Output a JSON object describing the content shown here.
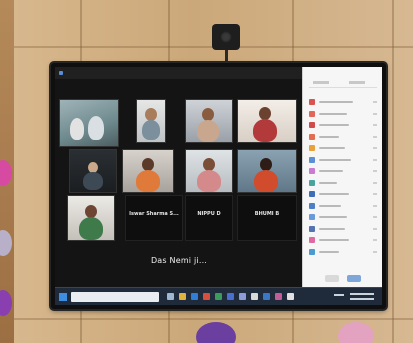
{
  "scene": {
    "meeting_window": {
      "participants": [
        {
          "name": "",
          "label": ""
        },
        {
          "name": "",
          "label": ""
        },
        {
          "name": "",
          "label": ""
        },
        {
          "name": "",
          "label": ""
        },
        {
          "name": "",
          "label": ""
        },
        {
          "name": "",
          "label": ""
        },
        {
          "name": "",
          "label": ""
        },
        {
          "name": "",
          "label": ""
        },
        {
          "name": "",
          "label": ""
        },
        {
          "name": "",
          "label": "Iswar Sharma S..."
        },
        {
          "name": "",
          "label": "NIPPU D"
        },
        {
          "name": "",
          "label": "BHUMI B"
        }
      ],
      "caption": "Das Nemi ji..."
    },
    "colors": {
      "wall": "#cba879",
      "screen_bg": "#141414",
      "sidebar_bg": "#f6f6f6",
      "taskbar": "#1f2b3a"
    }
  }
}
